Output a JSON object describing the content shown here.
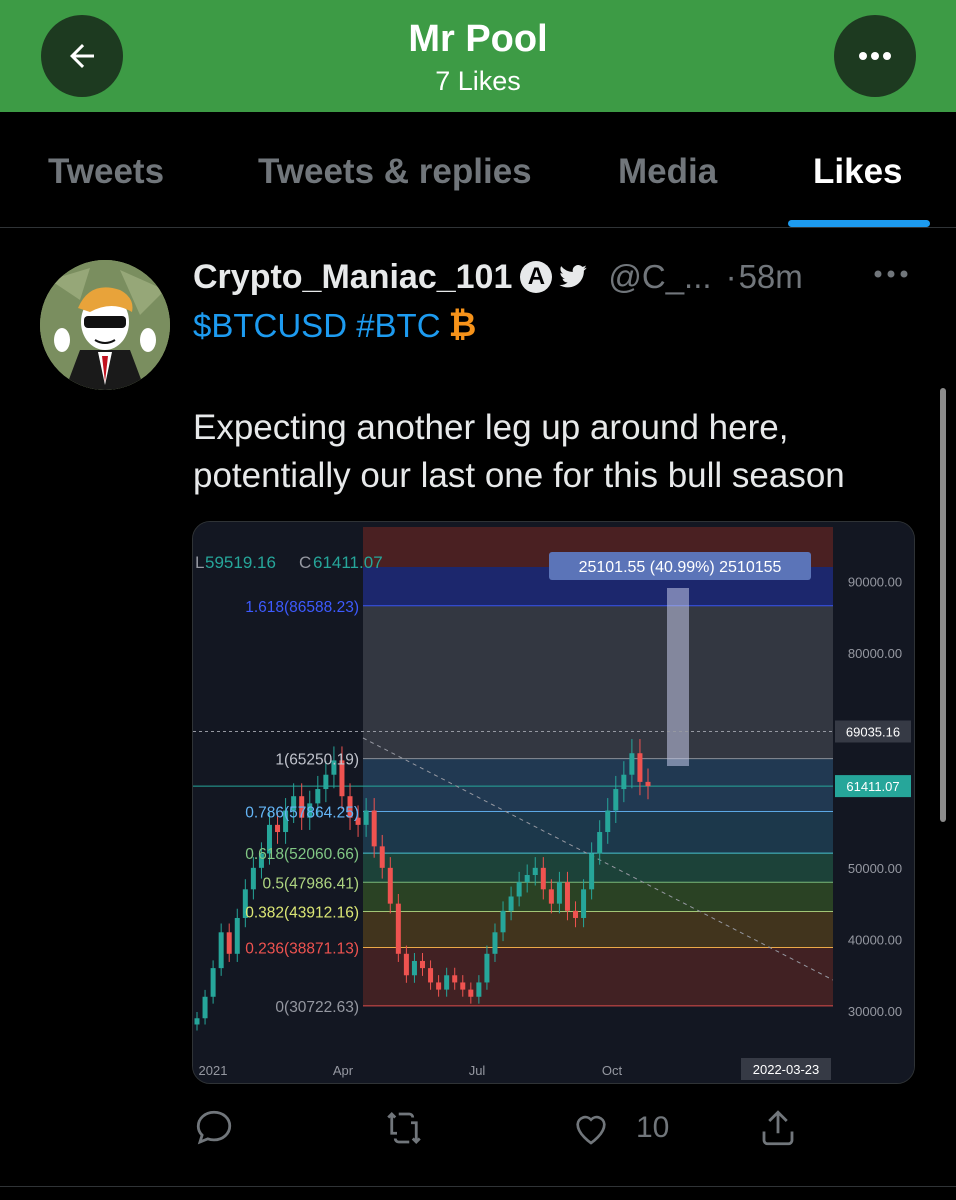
{
  "header": {
    "title": "Mr Pool",
    "subtitle": "7 Likes",
    "back_icon": "arrow-left-icon",
    "more_icon": "more-horizontal-icon",
    "bg_color": "#3d9b45"
  },
  "tabs": [
    {
      "label": "Tweets",
      "active": false
    },
    {
      "label": "Tweets & replies",
      "active": false
    },
    {
      "label": "Media",
      "active": false
    },
    {
      "label": "Likes",
      "active": true
    }
  ],
  "tweet": {
    "display_name": "Crypto_Maniac_101",
    "badge_letter": "A",
    "handle": "@C_...",
    "separator": "·",
    "time": "58m",
    "hashtags": "$BTCUSD #BTC",
    "text": "Expecting another leg up around here, potentially our last one for this bull season",
    "actions": {
      "reply_count": "",
      "retweet_count": "",
      "like_count": "10"
    }
  },
  "chart_data": {
    "type": "candlestick",
    "ohlc_header": {
      "low_label": "L",
      "low": "59519.16",
      "close_label": "C",
      "close": "61411.07"
    },
    "measure_label": "25101.55 (40.99%) 2510155",
    "fib_levels": [
      {
        "label": "1.618(86588.23)",
        "ratio": 1.618,
        "price": 86588.23
      },
      {
        "label": "1(65250.19)",
        "ratio": 1,
        "price": 65250.19
      },
      {
        "label": "0.786(57864.25)",
        "ratio": 0.786,
        "price": 57864.25
      },
      {
        "label": "0.618(52060.66)",
        "ratio": 0.618,
        "price": 52060.66
      },
      {
        "label": "0.5(47986.41)",
        "ratio": 0.5,
        "price": 47986.41
      },
      {
        "label": "0.382(43912.16)",
        "ratio": 0.382,
        "price": 43912.16
      },
      {
        "label": "0.236(38871.13)",
        "ratio": 0.236,
        "price": 38871.13
      },
      {
        "label": "0(30722.63)",
        "ratio": 0,
        "price": 30722.63
      }
    ],
    "y_ticks": [
      "90000.00",
      "80000.00",
      "50000.00",
      "40000.00",
      "30000.00"
    ],
    "price_tags": [
      {
        "label": "69035.16",
        "value": 69035.16,
        "color": "#363a45"
      },
      {
        "label": "61411.07",
        "value": 61411.07,
        "color": "#26a69a"
      }
    ],
    "x_ticks": [
      "2021",
      "Apr",
      "Jul",
      "Oct"
    ],
    "date_tag": "2022-03-23",
    "close_series": [
      29000,
      32000,
      36000,
      41000,
      38000,
      43000,
      47000,
      50000,
      52000,
      56000,
      55000,
      58000,
      60000,
      57000,
      59000,
      61000,
      63000,
      65000,
      60000,
      57000,
      56000,
      58000,
      53000,
      50000,
      45000,
      38000,
      35000,
      37000,
      36000,
      34000,
      33000,
      35000,
      34000,
      33000,
      32000,
      34000,
      38000,
      41000,
      44000,
      46000,
      48000,
      49000,
      50000,
      47000,
      45000,
      48000,
      44000,
      43000,
      47000,
      52000,
      55000,
      58000,
      61000,
      63000,
      66000,
      62000,
      61411
    ]
  }
}
